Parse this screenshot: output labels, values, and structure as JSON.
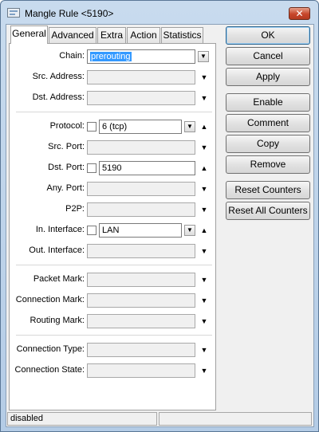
{
  "window": {
    "title": "Mangle Rule <5190>",
    "close_glyph": "✕"
  },
  "tabs": [
    {
      "label": "General",
      "active": true
    },
    {
      "label": "Advanced"
    },
    {
      "label": "Extra"
    },
    {
      "label": "Action"
    },
    {
      "label": "Statistics"
    }
  ],
  "fields": {
    "chain": {
      "label": "Chain:",
      "value": "prerouting"
    },
    "src_address": {
      "label": "Src. Address:"
    },
    "dst_address": {
      "label": "Dst. Address:"
    },
    "protocol": {
      "label": "Protocol:",
      "value": "6 (tcp)"
    },
    "src_port": {
      "label": "Src. Port:"
    },
    "dst_port": {
      "label": "Dst. Port:",
      "value": "5190"
    },
    "any_port": {
      "label": "Any. Port:"
    },
    "p2p": {
      "label": "P2P:"
    },
    "in_interface": {
      "label": "In. Interface:",
      "value": "LAN"
    },
    "out_interface": {
      "label": "Out. Interface:"
    },
    "packet_mark": {
      "label": "Packet Mark:"
    },
    "connection_mark": {
      "label": "Connection Mark:"
    },
    "routing_mark": {
      "label": "Routing Mark:"
    },
    "connection_type": {
      "label": "Connection Type:"
    },
    "connection_state": {
      "label": "Connection State:"
    }
  },
  "buttons": {
    "ok": "OK",
    "cancel": "Cancel",
    "apply": "Apply",
    "enable": "Enable",
    "comment": "Comment",
    "copy": "Copy",
    "remove": "Remove",
    "reset_counters": "Reset Counters",
    "reset_all_counters": "Reset All Counters"
  },
  "status": {
    "left": "disabled",
    "right": ""
  },
  "glyphs": {
    "down": "▼",
    "up": "▲",
    "dropdown": "▼"
  },
  "icons": [
    "window-app-icon",
    "close-icon",
    "dropdown-arrow-icon",
    "expand-down-icon",
    "collapse-up-icon"
  ]
}
